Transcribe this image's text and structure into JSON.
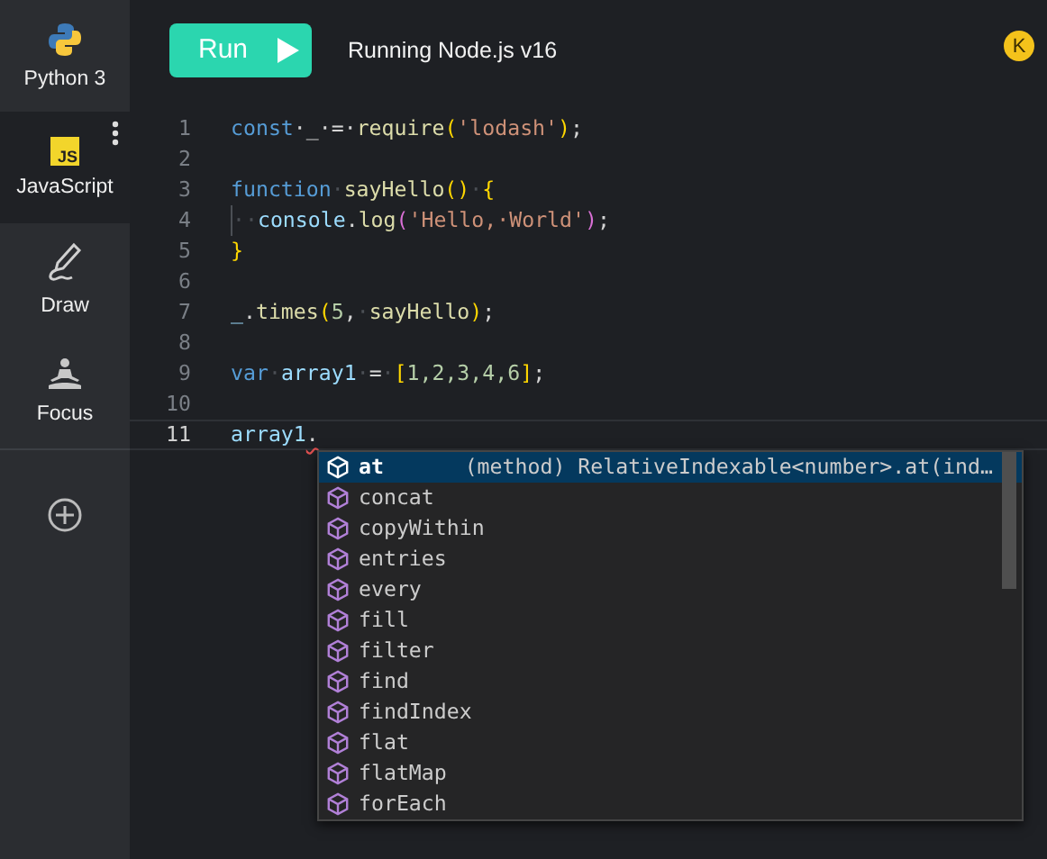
{
  "sidebar": {
    "items": [
      {
        "label": "Python 3",
        "selected": false
      },
      {
        "label": "JavaScript",
        "badge": "JS",
        "selected": true
      },
      {
        "label": "Draw",
        "selected": false
      },
      {
        "label": "Focus",
        "selected": false
      }
    ]
  },
  "toolbar": {
    "run_button": "Run",
    "status": "Running Node.js v16",
    "avatar": "K"
  },
  "editor": {
    "lines": [
      {
        "number": "1",
        "current": false,
        "tokens": [
          {
            "text": "const",
            "kind": "keyword"
          },
          {
            "text": "·_·=·",
            "kind": "punct"
          },
          {
            "text": "require",
            "kind": "func"
          },
          {
            "text": "(",
            "kind": "bracket"
          },
          {
            "text": "'lodash'",
            "kind": "string"
          },
          {
            "text": ")",
            "kind": "bracket"
          },
          {
            "text": ";",
            "kind": "punct"
          }
        ]
      },
      {
        "number": "2",
        "current": false
      },
      {
        "number": "3",
        "current": false,
        "tokens": [
          {
            "text": "function",
            "kind": "keyword"
          },
          {
            "text": "·",
            "kind": "space"
          },
          {
            "text": "sayHello",
            "kind": "func"
          },
          {
            "text": "()",
            "kind": "bracket"
          },
          {
            "text": "·",
            "kind": "space"
          },
          {
            "text": "{",
            "kind": "bracket"
          }
        ]
      },
      {
        "number": "4",
        "current": false,
        "tokens": [
          {
            "text": "··",
            "kind": "indent"
          },
          {
            "text": "console",
            "kind": "var"
          },
          {
            "text": ".",
            "kind": "punct"
          },
          {
            "text": "log",
            "kind": "func"
          },
          {
            "text": "(",
            "kind": "bracket2"
          },
          {
            "text": "'Hello,·World'",
            "kind": "string"
          },
          {
            "text": ")",
            "kind": "bracket2"
          },
          {
            "text": ";",
            "kind": "punct"
          }
        ]
      },
      {
        "number": "5",
        "current": false,
        "tokens": [
          {
            "text": "}",
            "kind": "bracket"
          }
        ]
      },
      {
        "number": "6",
        "current": false
      },
      {
        "number": "7",
        "current": false,
        "tokens": [
          {
            "text": "_",
            "kind": "var"
          },
          {
            "text": ".",
            "kind": "punct"
          },
          {
            "text": "times",
            "kind": "func"
          },
          {
            "text": "(",
            "kind": "bracket"
          },
          {
            "text": "5",
            "kind": "number"
          },
          {
            "text": ",",
            "kind": "punct"
          },
          {
            "text": "·",
            "kind": "space"
          },
          {
            "text": "sayHello",
            "kind": "func"
          },
          {
            "text": ")",
            "kind": "bracket"
          },
          {
            "text": ";",
            "kind": "punct"
          }
        ]
      },
      {
        "number": "8",
        "current": false
      },
      {
        "number": "9",
        "current": false,
        "tokens": [
          {
            "text": "var",
            "kind": "keyword"
          },
          {
            "text": "·",
            "kind": "space"
          },
          {
            "text": "array1",
            "kind": "var"
          },
          {
            "text": "·",
            "kind": "space"
          },
          {
            "text": "=",
            "kind": "punct"
          },
          {
            "text": "·",
            "kind": "space"
          },
          {
            "text": "[",
            "kind": "bracket"
          },
          {
            "text": "1,2,3,4,6",
            "kind": "plain"
          },
          {
            "text": "]",
            "kind": "bracket"
          },
          {
            "text": ";",
            "kind": "punct"
          }
        ]
      },
      {
        "number": "10",
        "current": false
      },
      {
        "number": "11",
        "current": true,
        "tokens": [
          {
            "text": "array1",
            "kind": "var"
          },
          {
            "text": ".",
            "kind": "error"
          }
        ]
      }
    ],
    "suggestions": [
      {
        "label": "at",
        "detail": "(method) RelativeIndexable<number>.at(ind…",
        "selected": true
      },
      {
        "label": "concat",
        "selected": false
      },
      {
        "label": "copyWithin",
        "selected": false
      },
      {
        "label": "entries",
        "selected": false
      },
      {
        "label": "every",
        "selected": false
      },
      {
        "label": "fill",
        "selected": false
      },
      {
        "label": "filter",
        "selected": false
      },
      {
        "label": "find",
        "selected": false
      },
      {
        "label": "findIndex",
        "selected": false
      },
      {
        "label": "flat",
        "selected": false
      },
      {
        "label": "flatMap",
        "selected": false
      },
      {
        "label": "forEach",
        "selected": false
      }
    ]
  }
}
